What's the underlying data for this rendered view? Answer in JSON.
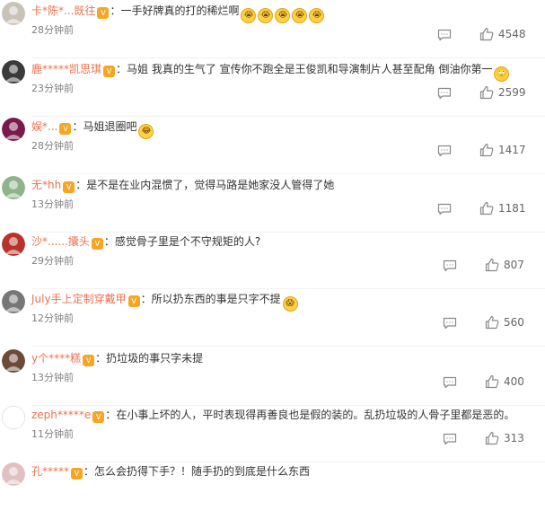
{
  "comments": [
    {
      "name": "卡*陈*...既往",
      "text": "一手好牌真的打的稀烂啊",
      "emojis": [
        "😭",
        "😭",
        "😭",
        "😭",
        "😭"
      ],
      "time": "28分钟前",
      "likes": "4548",
      "avatar_color": "#c9c2b6"
    },
    {
      "name": "鹿*****凯思琪",
      "text": "马姐 我真的生气了 宣传你不跑全是王俊凯和导演制片人甚至配角 倒油你第一",
      "emojis": [
        "🙄"
      ],
      "time": "23分钟前",
      "likes": "2599",
      "avatar_color": "#3a3a3a"
    },
    {
      "name": "娱*...",
      "text": "马姐退圈吧",
      "emojis": [
        "😂"
      ],
      "time": "28分钟前",
      "likes": "1417",
      "avatar_color": "#7a1a4a"
    },
    {
      "name": "无*hh",
      "text": "是不是在业内混惯了，觉得马路是她家没人管得了她",
      "emojis": [],
      "time": "13分钟前",
      "likes": "1181",
      "avatar_color": "#8fb38a"
    },
    {
      "name": "沙*......攮头",
      "text": "感觉骨子里是个不守规矩的人?",
      "emojis": [],
      "time": "29分钟前",
      "likes": "807",
      "avatar_color": "#b5332a"
    },
    {
      "name": "July手上定制穿戴甲",
      "text": "所以扔东西的事是只字不提",
      "emojis": [
        "😱"
      ],
      "time": "12分钟前",
      "likes": "560",
      "avatar_color": "#777777"
    },
    {
      "name": "y个****糕",
      "text": "扔垃圾的事只字未提",
      "emojis": [],
      "time": "13分钟前",
      "likes": "400",
      "avatar_color": "#6b4a3a"
    },
    {
      "name": "zeph*****e",
      "text": "在小事上坏的人，平时表现得再善良也是假的装的。乱扔垃圾的人骨子里都是恶的。",
      "emojis": [],
      "time": "11分钟前",
      "likes": "313",
      "avatar_color": "#ffffff"
    },
    {
      "name": "孔*****",
      "text": "怎么会扔得下手？！随手扔的到底是什么东西",
      "emojis": [],
      "time": "",
      "likes": "",
      "avatar_color": "#e0c0c0"
    }
  ],
  "ui": {
    "vip_label": "V",
    "colon": "：",
    "name_color": "#eb7350",
    "icon_color": "#8a8a8a",
    "comment_icon": "comment-icon",
    "like_icon": "thumbs-up-icon"
  }
}
